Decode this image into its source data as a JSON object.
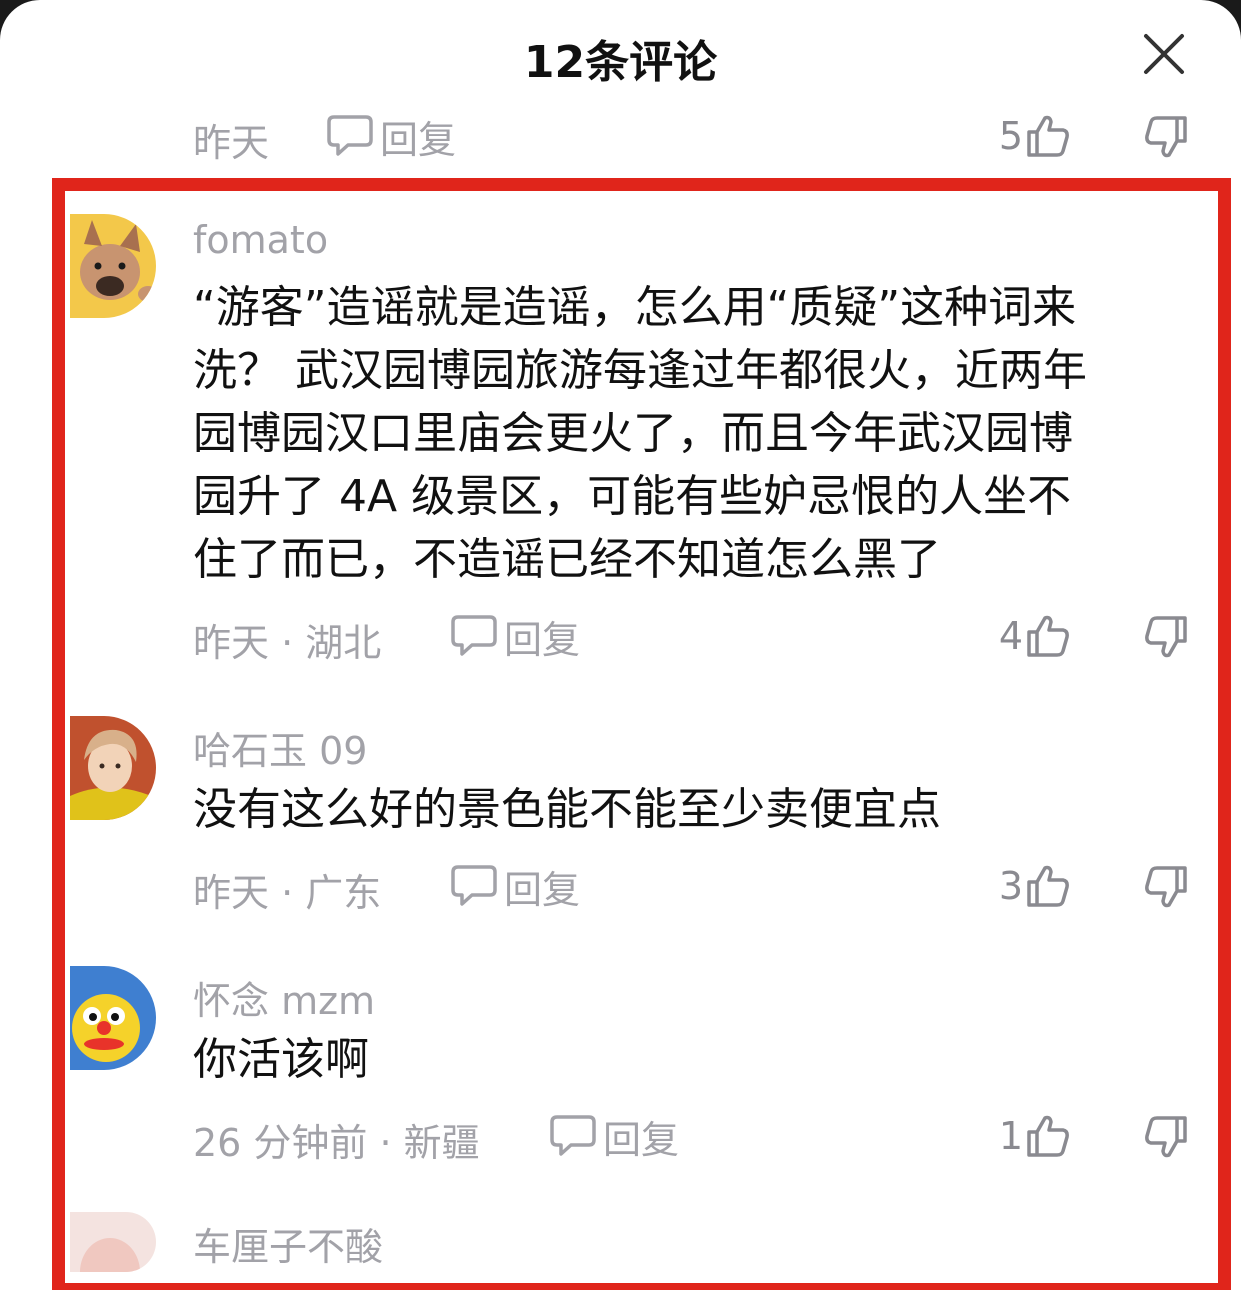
{
  "header": {
    "title": "12条评论"
  },
  "top_partial": {
    "time": "昨天",
    "reply_label": "回复",
    "likes": "5"
  },
  "comments": [
    {
      "username": "fomato",
      "text": "“游客”造谣就是造谣，怎么用“质疑”这种词来\n洗？ 武汉园博园旅游每逢过年都很火，近两年\n园博园汉口里庙会更火了，而且今年武汉园博\n园升了 4A 级景区，可能有些妒忌恨的人坐不\n住了而已，不造谣已经不知道怎么黑了",
      "meta": "昨天 · 湖北",
      "reply_label": "回复",
      "likes": "4"
    },
    {
      "username": "哈石玉 09",
      "text": "没有这么好的景色能不能至少卖便宜点",
      "meta": "昨天 · 广东",
      "reply_label": "回复",
      "likes": "3"
    },
    {
      "username": "怀念 mzm",
      "text": "你活该啊",
      "meta": "26 分钟前 · 新疆",
      "reply_label": "回复",
      "likes": "1"
    },
    {
      "username": "车厘子不酸"
    }
  ],
  "colors": {
    "highlight_border": "#e0251b",
    "meta_text": "#a2a2a8",
    "body_text": "#111111"
  },
  "icons": [
    "close-icon",
    "comment-bubble-icon",
    "thumbs-up-icon",
    "thumbs-down-icon"
  ]
}
